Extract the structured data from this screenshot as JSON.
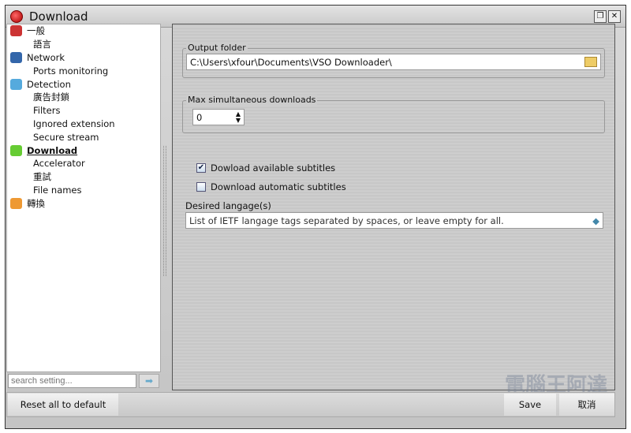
{
  "window": {
    "title": "Download",
    "buttons": [
      "restore",
      "close"
    ]
  },
  "sidebar": {
    "items": [
      {
        "label": "一般",
        "level": 0,
        "icon": "tools-icon",
        "color": "#c33"
      },
      {
        "label": "語言",
        "level": 1
      },
      {
        "label": "Network",
        "level": 0,
        "icon": "network-icon",
        "color": "#36a"
      },
      {
        "label": "Ports monitoring",
        "level": 1
      },
      {
        "label": "Detection",
        "level": 0,
        "icon": "magnifier-icon",
        "color": "#5ad"
      },
      {
        "label": "廣告封鎖",
        "level": 1
      },
      {
        "label": "Filters",
        "level": 1
      },
      {
        "label": "Ignored extension",
        "level": 1
      },
      {
        "label": "Secure stream",
        "level": 1
      },
      {
        "label": "Download",
        "level": 0,
        "icon": "download-icon",
        "color": "#6c3",
        "active": true
      },
      {
        "label": "Accelerator",
        "level": 1
      },
      {
        "label": "重試",
        "level": 1
      },
      {
        "label": "File names",
        "level": 1
      },
      {
        "label": "轉換",
        "level": 0,
        "icon": "convert-icon",
        "color": "#e93"
      }
    ],
    "search_placeholder": "search setting..."
  },
  "main": {
    "output_folder": {
      "label": "Output folder",
      "value": "C:\\Users\\xfour\\Documents\\VSO Downloader\\"
    },
    "max_downloads": {
      "label": "Max simultaneous downloads",
      "value": "0"
    },
    "subtitles": {
      "available": {
        "label": "Dowload available subtitles",
        "checked": true
      },
      "automatic": {
        "label": "Download automatic subtitles",
        "checked": false
      }
    },
    "languages": {
      "label": "Desired langage(s)",
      "placeholder": "List of IETF langage tags separated by spaces, or leave empty for all."
    }
  },
  "footer": {
    "reset": "Reset all to default",
    "save": "Save",
    "cancel": "取消"
  },
  "watermark": "電腦王阿達"
}
